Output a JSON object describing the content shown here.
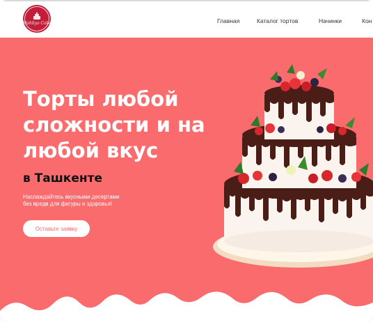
{
  "header": {
    "logo_text": "Mahliyo Cake",
    "nav": [
      "Главная",
      "Каталог тортов",
      "Начинки",
      "Кон"
    ]
  },
  "hero": {
    "title_lines": [
      "Торты любой",
      "сложности и на",
      "любой вкус"
    ],
    "subtitle": "в Ташкенте",
    "description_lines": [
      "Наслаждайтесь вкусными десертами",
      "без вредв для фигуры и здоровья!"
    ],
    "cta_label": "Оставьте заявку"
  },
  "colors": {
    "hero_bg": "#fa6b6e",
    "logo_bg": "#c21e3a",
    "text_dark": "#111111",
    "white": "#ffffff"
  },
  "icons": [
    "logo-cake-icon",
    "cake-image"
  ]
}
